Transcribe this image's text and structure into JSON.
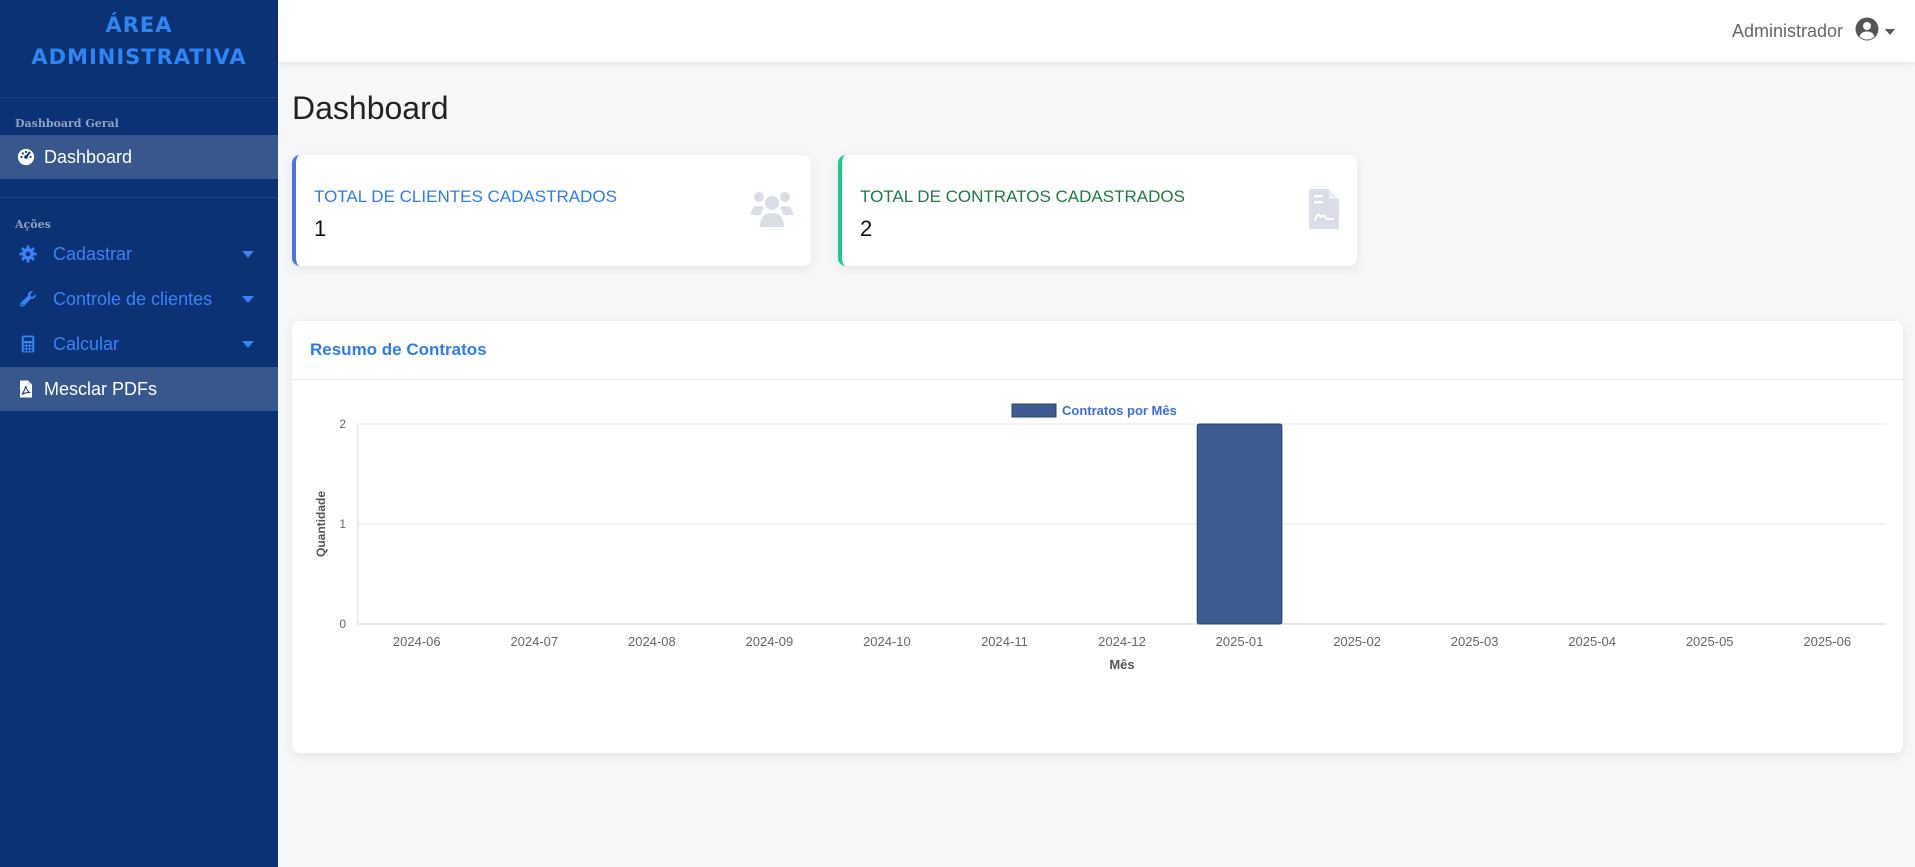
{
  "brand": {
    "line1": "ÁREA",
    "line2": "ADMINISTRATIVA"
  },
  "sidebar": {
    "heading1": "Dashboard Geral",
    "heading2": "Ações",
    "items": [
      {
        "label": "Dashboard",
        "icon": "gauge-icon"
      },
      {
        "label": "Cadastrar",
        "icon": "gear-icon"
      },
      {
        "label": "Controle de clientes",
        "icon": "wrench-icon"
      },
      {
        "label": "Calcular",
        "icon": "calculator-icon"
      },
      {
        "label": "Mesclar PDFs",
        "icon": "pdf-file-icon"
      }
    ]
  },
  "topbar": {
    "user_name": "Administrador"
  },
  "page": {
    "title": "Dashboard"
  },
  "cards": [
    {
      "title": "TOTAL DE CLIENTES CADASTRADOS",
      "value": "1",
      "icon": "users-icon"
    },
    {
      "title": "TOTAL DE CONTRATOS CADASTRADOS",
      "value": "2",
      "icon": "contract-file-icon"
    }
  ],
  "chart_panel": {
    "title": "Resumo de Contratos"
  },
  "colors": {
    "sidebar_bg": "#0b3275",
    "primary": "#2d7de8",
    "success": "#1d7a45",
    "bar": "#3d5b8e"
  },
  "chart_data": {
    "type": "bar",
    "legend": "Contratos por Mês",
    "legend_position": "top-center",
    "xlabel": "Mês",
    "ylabel": "Quantidade",
    "categories": [
      "2024-06",
      "2024-07",
      "2024-08",
      "2024-09",
      "2024-10",
      "2024-11",
      "2024-12",
      "2025-01",
      "2025-02",
      "2025-03",
      "2025-04",
      "2025-05",
      "2025-06"
    ],
    "series": [
      {
        "name": "Contratos por Mês",
        "values": [
          0,
          0,
          0,
          0,
          0,
          0,
          0,
          2,
          0,
          0,
          0,
          0,
          0
        ]
      }
    ],
    "ylim": [
      0,
      2
    ],
    "yticks": [
      0,
      1,
      2
    ],
    "grid": true
  }
}
